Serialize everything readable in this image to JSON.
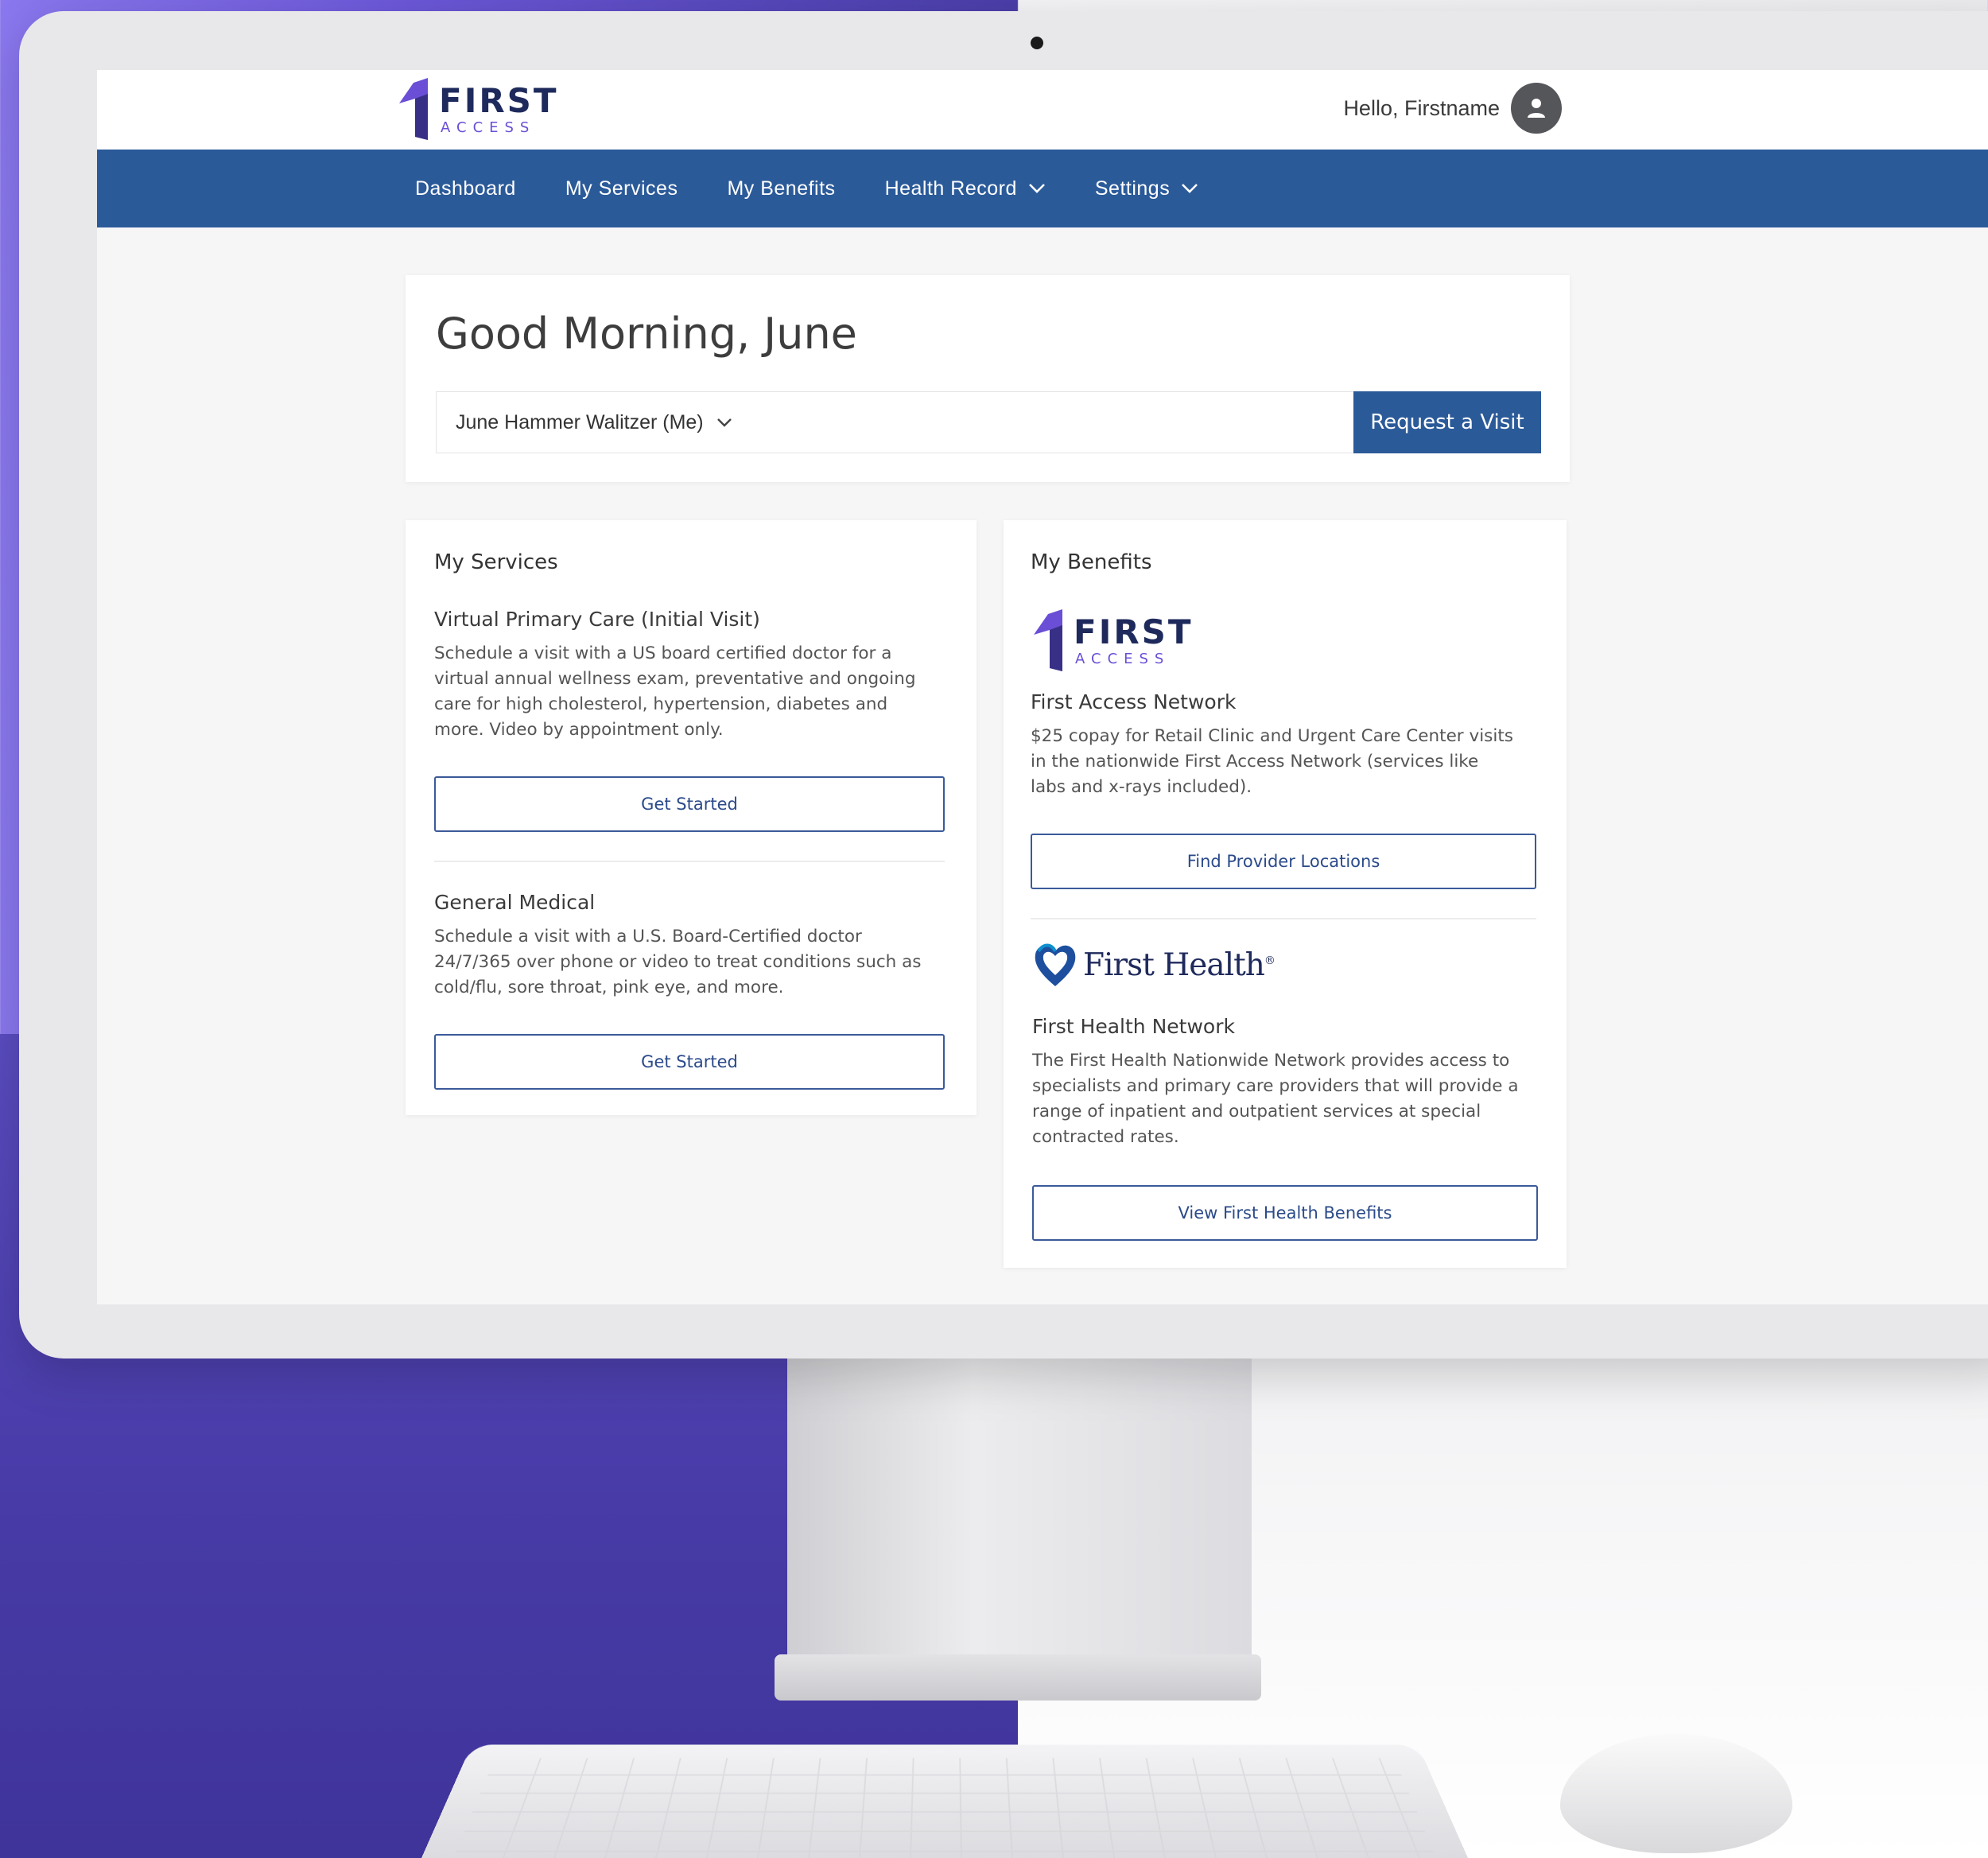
{
  "header": {
    "logo_word": "FIRST",
    "logo_sub": "ACCESS",
    "greeting": "Hello, Firstname"
  },
  "nav": {
    "items": [
      {
        "label": "Dashboard"
      },
      {
        "label": "My Services"
      },
      {
        "label": "My Benefits"
      },
      {
        "label": "Health Record"
      },
      {
        "label": "Settings"
      }
    ]
  },
  "welcome": {
    "title": "Good Morning, June",
    "member_selected": "June Hammer Walitzer (Me)",
    "request_button": "Request a Visit"
  },
  "services": {
    "heading": "My Services",
    "items": [
      {
        "title": "Virtual Primary Care (Initial Visit)",
        "desc_lines": [
          "Schedule a visit with a US board certified doctor for a",
          "virtual annual wellness exam, preventative and ongoing",
          "care for high cholesterol, hypertension, diabetes and",
          "more. Video by appointment only."
        ],
        "button": "Get Started"
      },
      {
        "title": "General Medical",
        "desc_lines": [
          "Schedule a visit with a U.S. Board-Certified doctor",
          "24/7/365 over phone or video to treat conditions such as",
          "cold/flu, sore throat, pink eye, and more."
        ],
        "button": "Get Started"
      }
    ]
  },
  "benefits": {
    "heading": "My Benefits",
    "items": [
      {
        "title": "First Access Network",
        "desc_lines": [
          "$25 copay for Retail Clinic and Urgent Care Center visits",
          "in the nationwide First Access Network (services like",
          "labs and x-rays included)."
        ],
        "button": "Find Provider Locations"
      },
      {
        "logo_word": "First Health",
        "logo_mark": "®",
        "title": "First Health Network",
        "desc_lines": [
          "The First Health Nationwide Network provides access to",
          "specialists and primary care providers that will provide a",
          "range of inpatient and outpatient services at special",
          "contracted rates."
        ],
        "button": "View First Health Benefits"
      }
    ]
  },
  "colors": {
    "brand_blue": "#2b5a99",
    "brand_purple": "#6a4fd6",
    "logo_navy": "#1f2a5c"
  },
  "icons": {
    "avatar": "user-icon",
    "dropdown": "chevron-down-icon",
    "first_health": "heart-icon"
  }
}
